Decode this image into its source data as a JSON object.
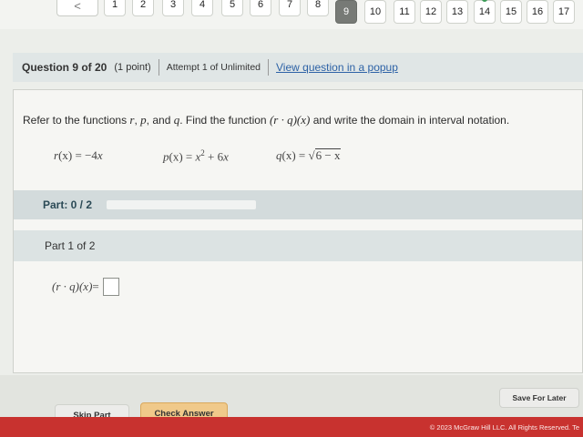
{
  "nav": {
    "prev_glyph": "<",
    "questions": [
      "1",
      "2",
      "3",
      "4",
      "5",
      "6",
      "7",
      "8",
      "9",
      "10",
      "11",
      "12",
      "13",
      "14",
      "15",
      "16",
      "17"
    ],
    "current": "9"
  },
  "header": {
    "title": "Question 9 of 20",
    "points": "(1 point)",
    "attempt": "Attempt 1 of Unlimited",
    "popup_link": "View question in a popup"
  },
  "question": {
    "prompt_start": "Refer to the functions",
    "var_r": "r",
    "comma1": ",",
    "var_p": "p",
    "and": ", and",
    "var_q": "q",
    "prompt_mid": ". Find the function",
    "composite": "(r · q)(x)",
    "prompt_end": "and write the domain in interval notation.",
    "f_r": {
      "name": "r",
      "arg": "(x)",
      "eq": " = −4",
      "var": "x"
    },
    "f_p": {
      "name": "p",
      "arg": "(x)",
      "eq": " = ",
      "var1": "x",
      "sup": "2",
      "rest": " + 6",
      "var2": "x"
    },
    "f_q": {
      "name": "q",
      "arg": "(x)",
      "eq": " = √",
      "radicand": "6 − x"
    }
  },
  "part_status": {
    "label": "Part: 0 / 2",
    "progress": 0
  },
  "part_label": "Part 1 of 2",
  "answer": {
    "expr": "(r · q)(x)",
    "eq": " =",
    "value": ""
  },
  "footer": {
    "skip": "Skip Part",
    "check": "Check Answer",
    "save": "Save For Later",
    "copyright": "© 2023 McGraw Hill LLC. All Rights Reserved.   Te"
  }
}
